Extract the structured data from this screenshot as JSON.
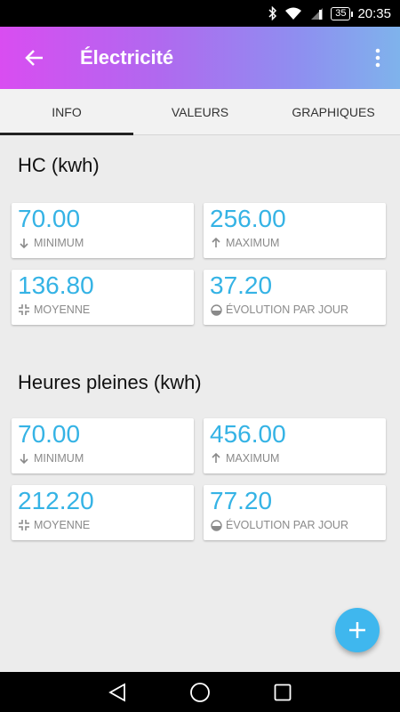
{
  "status_bar": {
    "battery": "35",
    "time": "20:35"
  },
  "app_bar": {
    "title": "Électricité"
  },
  "tabs": [
    {
      "label": "INFO",
      "active": true
    },
    {
      "label": "VALEURS",
      "active": false
    },
    {
      "label": "GRAPHIQUES",
      "active": false
    }
  ],
  "sections": [
    {
      "title": "HC (kwh)",
      "cards": [
        {
          "value": "70.00",
          "label": "MINIMUM",
          "icon": "arrow-down-icon"
        },
        {
          "value": "256.00",
          "label": "MAXIMUM",
          "icon": "arrow-up-icon"
        },
        {
          "value": "136.80",
          "label": "MOYENNE",
          "icon": "compress-icon"
        },
        {
          "value": "37.20",
          "label": "ÉVOLUTION PAR JOUR",
          "icon": "gauge-icon"
        }
      ]
    },
    {
      "title": "Heures pleines (kwh)",
      "cards": [
        {
          "value": "70.00",
          "label": "MINIMUM",
          "icon": "arrow-down-icon"
        },
        {
          "value": "456.00",
          "label": "MAXIMUM",
          "icon": "arrow-up-icon"
        },
        {
          "value": "212.20",
          "label": "MOYENNE",
          "icon": "compress-icon"
        },
        {
          "value": "77.20",
          "label": "ÉVOLUTION PAR JOUR",
          "icon": "gauge-icon"
        }
      ]
    }
  ],
  "colors": {
    "accent": "#35b3e5",
    "fab": "#3fb7ee"
  }
}
